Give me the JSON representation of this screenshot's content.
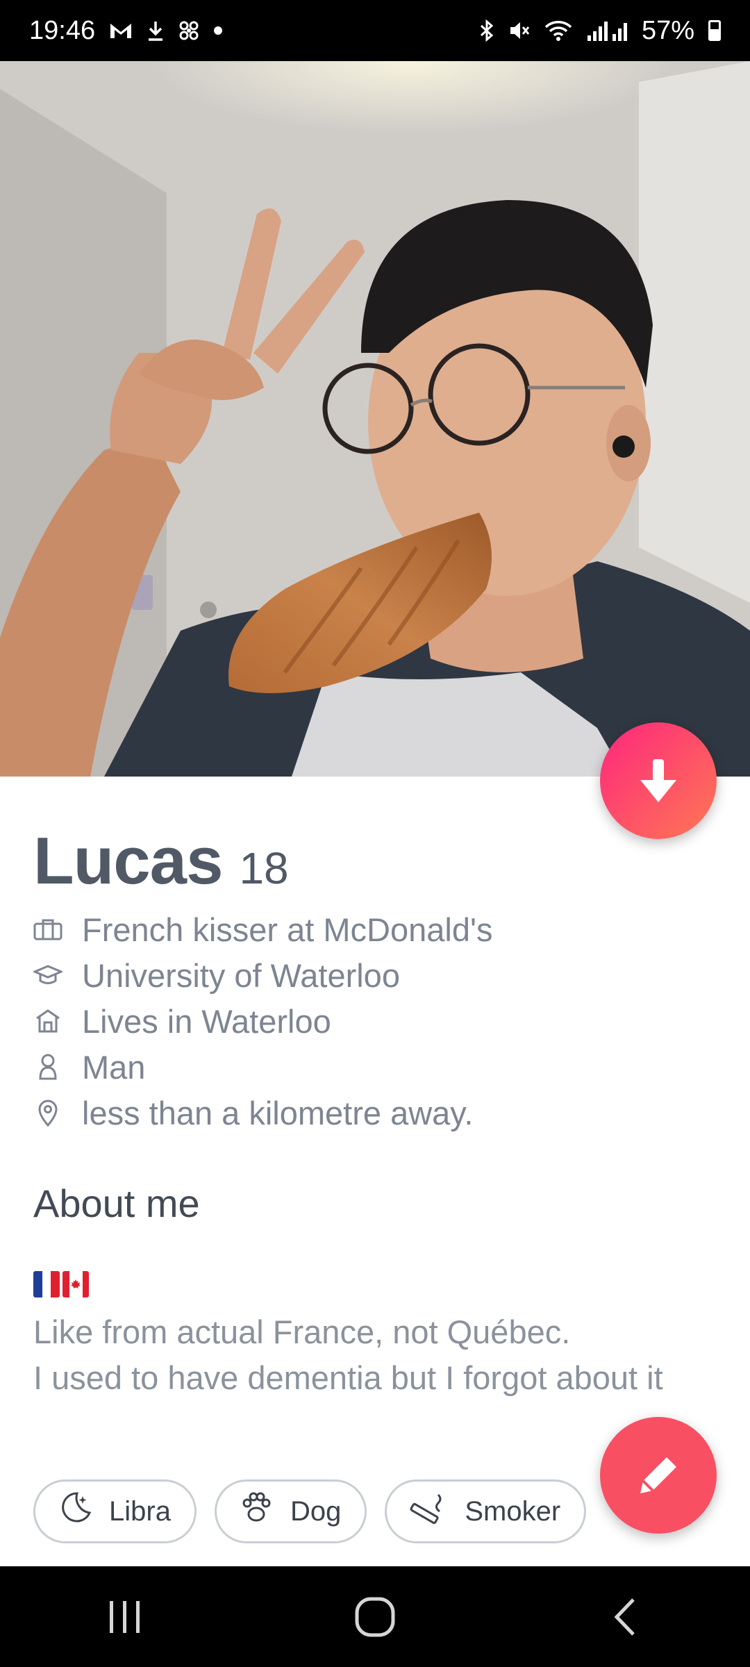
{
  "status_bar": {
    "time": "19:46",
    "battery": "57%",
    "left_icons": [
      "gmail-icon",
      "download-icon",
      "fan-icon",
      "dot-icon"
    ],
    "right_icons": [
      "bluetooth-icon",
      "mute-icon",
      "wifi-icon",
      "signal-icon",
      "battery-icon"
    ]
  },
  "profile": {
    "name": "Lucas",
    "age": "18",
    "job": "French kisser at McDonald's",
    "school": "University of Waterloo",
    "lives": "Lives in Waterloo",
    "gender": "Man",
    "distance": "less than a kilometre away."
  },
  "about": {
    "title": "About me",
    "flags": [
      "france-flag-icon",
      "canada-flag-icon"
    ],
    "bio_line1": "Like from actual France, not Québec.",
    "bio_line2": "I used to have dementia but I forgot about it"
  },
  "chips": [
    {
      "label": "Libra",
      "icon": "moon-stars-icon"
    },
    {
      "label": "Dog",
      "icon": "paw-icon"
    },
    {
      "label": "Smoker",
      "icon": "cigarette-icon"
    }
  ],
  "colors": {
    "accent_gradient_start": "#fd267d",
    "accent_gradient_end": "#ff7854",
    "edit_button": "#f84f62",
    "name_text": "#505965",
    "info_text": "#7c8591"
  }
}
